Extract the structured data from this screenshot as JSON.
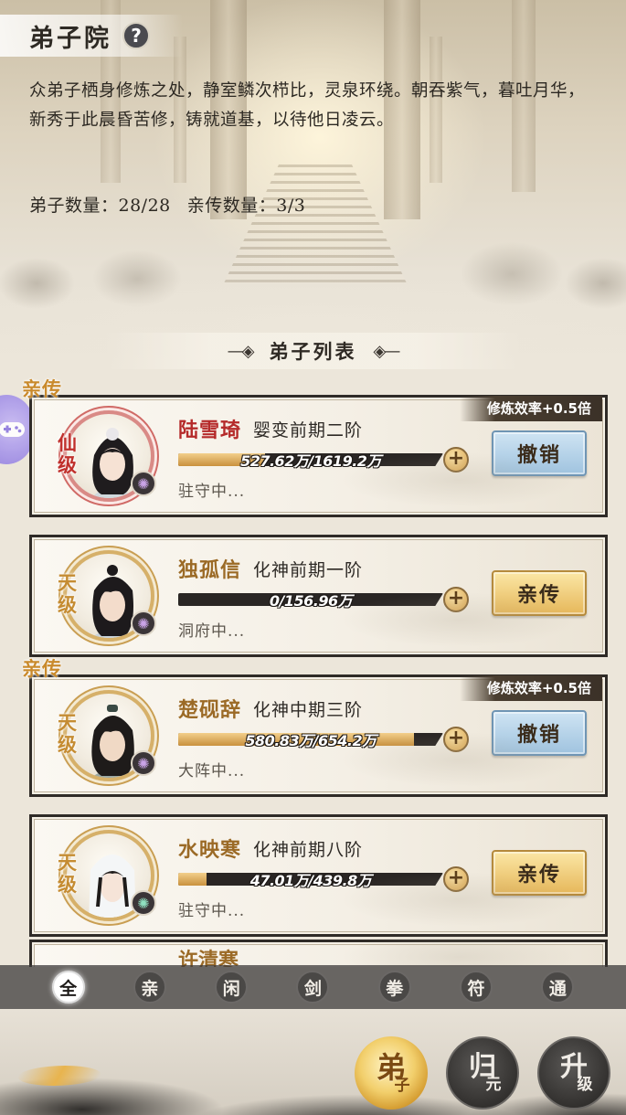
{
  "header": {
    "title": "弟子院",
    "help": "?",
    "intro": "众弟子栖身修炼之处，静室鳞次栉比，灵泉环绕。朝吞紫气，暮吐月华，新秀于此晨昏苦修，铸就道基，以待他日凌云。",
    "disciple_count": "弟子数量：28/28",
    "direct_count": "亲传数量：3/3"
  },
  "list_heading": "弟子列表",
  "cards": [
    {
      "tag": "亲传",
      "badge": "修炼效率+0.5倍",
      "grade": "仙级",
      "name": "陆雪琦",
      "realm": "婴变前期二阶",
      "progress": "527.62万/1619.2万",
      "progress_ratio": 0.326,
      "status": "驻守中...",
      "action": "撤销",
      "element": "purple-swirl"
    },
    {
      "tag": "",
      "badge": "",
      "grade": "天级",
      "name": "独孤信",
      "realm": "化神前期一阶",
      "progress": "0/156.96万",
      "progress_ratio": 0.0,
      "status": "洞府中...",
      "action": "亲传",
      "element": "purple-swirl"
    },
    {
      "tag": "亲传",
      "badge": "修炼效率+0.5倍",
      "grade": "天级",
      "name": "楚砚辞",
      "realm": "化神中期三阶",
      "progress": "580.83万/654.2万",
      "progress_ratio": 0.888,
      "status": "大阵中...",
      "action": "撤销",
      "element": "purple-swirl"
    },
    {
      "tag": "",
      "badge": "",
      "grade": "天级",
      "name": "水映寒",
      "realm": "化神前期八阶",
      "progress": "47.01万/439.8万",
      "progress_ratio": 0.107,
      "status": "驻守中...",
      "action": "亲传",
      "element": "green-swirl"
    }
  ],
  "partial_card": {
    "name": "许清寒"
  },
  "filters": [
    "全",
    "亲",
    "闲",
    "剑",
    "拳",
    "符",
    "通"
  ],
  "active_filter": "全",
  "bottom_nav": [
    {
      "big": "弟",
      "small": "子",
      "active": true
    },
    {
      "big": "归",
      "small": "元",
      "active": false
    },
    {
      "big": "升",
      "small": "级",
      "active": false
    }
  ],
  "colors": {
    "red_name": "#b52a2a",
    "gold_name": "#9b6a26",
    "tag_gold": "#c98a2c",
    "blue_button": "#9fc3df",
    "gold_button": "#e6b75a"
  }
}
